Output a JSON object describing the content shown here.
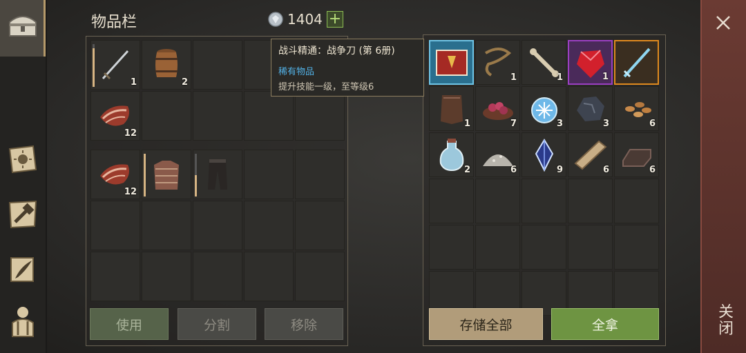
{
  "header": {
    "title": "物品栏",
    "currency_amount": "1404",
    "currency_icon": "silver-coin-icon",
    "add_label": "+"
  },
  "sidebar": {
    "items": [
      {
        "name": "inventory",
        "icon": "chest-icon",
        "active": true
      },
      {
        "name": "skills",
        "icon": "sun-tome-icon"
      },
      {
        "name": "crafting",
        "icon": "hammer-map-icon"
      },
      {
        "name": "quests",
        "icon": "quill-scroll-icon"
      },
      {
        "name": "character",
        "icon": "character-icon"
      }
    ]
  },
  "inventory": {
    "top_slots": [
      {
        "item": "katana",
        "icon": "katana-icon",
        "count": "1",
        "durability": 0.9
      },
      {
        "item": "barrel",
        "icon": "barrel-icon",
        "count": "2"
      },
      {},
      {},
      {},
      {
        "item": "raw-meat",
        "icon": "raw-meat-icon",
        "count": "12"
      },
      {},
      {},
      {},
      {}
    ],
    "bottom_slots": [
      {
        "item": "raw-meat",
        "icon": "raw-meat-icon",
        "count": "12"
      },
      {
        "item": "chainmail",
        "icon": "chainmail-icon",
        "durability": 1.0
      },
      {
        "item": "pants",
        "icon": "pants-icon",
        "durability": 0.5
      },
      {},
      {},
      {},
      {},
      {},
      {},
      {},
      {},
      {},
      {},
      {},
      {}
    ],
    "buttons": {
      "use": "使用",
      "split": "分割",
      "remove": "移除"
    }
  },
  "tooltip": {
    "title": "战斗精通：战争刀 (第 6册)",
    "rarity": "稀有物品",
    "description": "提升技能一级，至等级6"
  },
  "storage": {
    "slots": [
      {
        "item": "book",
        "icon": "book-icon",
        "selected": true
      },
      {
        "item": "rope",
        "icon": "rope-icon",
        "count": "1"
      },
      {
        "item": "bone",
        "icon": "bone-icon",
        "count": "1"
      },
      {
        "item": "ruby",
        "icon": "ruby-icon",
        "count": "1",
        "rarity": "purple"
      },
      {
        "item": "ice-sword",
        "icon": "ice-sword-icon",
        "rarity": "orange"
      },
      {
        "item": "leather",
        "icon": "leather-icon",
        "count": "1"
      },
      {
        "item": "berries",
        "icon": "berry-bowl-icon",
        "count": "7"
      },
      {
        "item": "ice-orb",
        "icon": "ice-orb-icon",
        "count": "3"
      },
      {
        "item": "iron-ore",
        "icon": "iron-ore-icon",
        "count": "3"
      },
      {
        "item": "seeds",
        "icon": "seeds-icon",
        "count": "6"
      },
      {
        "item": "water",
        "icon": "water-flask-icon",
        "count": "2"
      },
      {
        "item": "powder",
        "icon": "powder-icon",
        "count": "6"
      },
      {
        "item": "crystal",
        "icon": "crystal-icon",
        "count": "9"
      },
      {
        "item": "plank",
        "icon": "plank-icon",
        "count": "6"
      },
      {
        "item": "ingot",
        "icon": "ingot-icon",
        "count": "6"
      },
      {},
      {},
      {},
      {},
      {},
      {},
      {},
      {},
      {},
      {},
      {},
      {},
      {},
      {},
      {}
    ],
    "buttons": {
      "store_all": "存储全部",
      "take_all": "全拿"
    }
  },
  "close": {
    "label": "关闭",
    "icon": "close-icon"
  },
  "colors": {
    "accent_green": "#6e9442",
    "rarity_purple": "#9b3fc2",
    "rarity_orange": "#e08a1e",
    "selected_blue": "#2a6f8e",
    "tooltip_blue": "#52b1e6"
  }
}
